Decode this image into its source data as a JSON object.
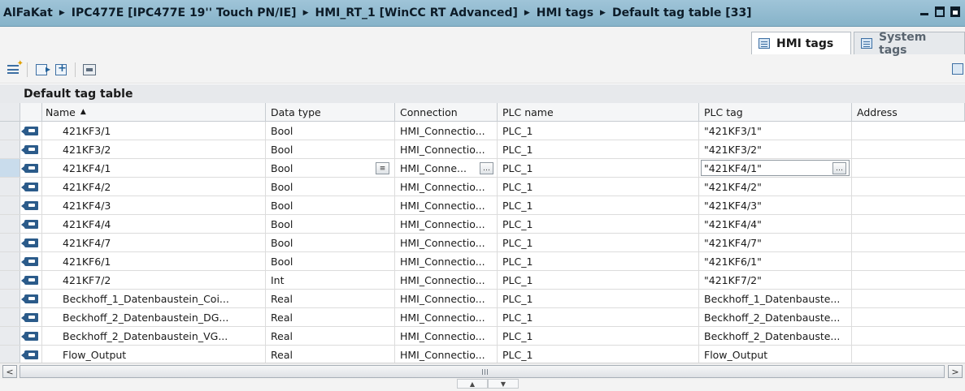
{
  "breadcrumb": [
    "AlFaKat",
    "IPC477E [IPC477E 19'' Touch PN/IE]",
    "HMI_RT_1 [WinCC RT Advanced]",
    "HMI tags",
    "Default tag table [33]"
  ],
  "tabs": {
    "hmi_tags": "HMI tags",
    "system_tags": "System tags"
  },
  "table_title": "Default tag table",
  "columns": {
    "name": "Name",
    "data_type": "Data type",
    "connection": "Connection",
    "plc_name": "PLC name",
    "plc_tag": "PLC tag",
    "address": "Address"
  },
  "rows": [
    {
      "name": "421KF3/1",
      "data_type": "Bool",
      "connection": "HMI_Connectio...",
      "plc_name": "PLC_1",
      "plc_tag": "\"421KF3/1\"",
      "address": ""
    },
    {
      "name": "421KF3/2",
      "data_type": "Bool",
      "connection": "HMI_Connectio...",
      "plc_name": "PLC_1",
      "plc_tag": "\"421KF3/2\"",
      "address": ""
    },
    {
      "name": "421KF4/1",
      "data_type": "Bool",
      "connection": "HMI_Conne...",
      "plc_name": "PLC_1",
      "plc_tag": "\"421KF4/1\"",
      "address": ""
    },
    {
      "name": "421KF4/2",
      "data_type": "Bool",
      "connection": "HMI_Connectio...",
      "plc_name": "PLC_1",
      "plc_tag": "\"421KF4/2\"",
      "address": ""
    },
    {
      "name": "421KF4/3",
      "data_type": "Bool",
      "connection": "HMI_Connectio...",
      "plc_name": "PLC_1",
      "plc_tag": "\"421KF4/3\"",
      "address": ""
    },
    {
      "name": "421KF4/4",
      "data_type": "Bool",
      "connection": "HMI_Connectio...",
      "plc_name": "PLC_1",
      "plc_tag": "\"421KF4/4\"",
      "address": ""
    },
    {
      "name": "421KF4/7",
      "data_type": "Bool",
      "connection": "HMI_Connectio...",
      "plc_name": "PLC_1",
      "plc_tag": "\"421KF4/7\"",
      "address": ""
    },
    {
      "name": "421KF6/1",
      "data_type": "Bool",
      "connection": "HMI_Connectio...",
      "plc_name": "PLC_1",
      "plc_tag": "\"421KF6/1\"",
      "address": ""
    },
    {
      "name": "421KF7/2",
      "data_type": "Int",
      "connection": "HMI_Connectio...",
      "plc_name": "PLC_1",
      "plc_tag": "\"421KF7/2\"",
      "address": ""
    },
    {
      "name": "Beckhoff_1_Datenbaustein_Coi...",
      "data_type": "Real",
      "connection": "HMI_Connectio...",
      "plc_name": "PLC_1",
      "plc_tag": "Beckhoff_1_Datenbauste...",
      "address": ""
    },
    {
      "name": "Beckhoff_2_Datenbaustein_DG...",
      "data_type": "Real",
      "connection": "HMI_Connectio...",
      "plc_name": "PLC_1",
      "plc_tag": "Beckhoff_2_Datenbauste...",
      "address": ""
    },
    {
      "name": "Beckhoff_2_Datenbaustein_VG...",
      "data_type": "Real",
      "connection": "HMI_Connectio...",
      "plc_name": "PLC_1",
      "plc_tag": "Beckhoff_2_Datenbauste...",
      "address": ""
    },
    {
      "name": "Flow_Output",
      "data_type": "Real",
      "connection": "HMI_Connectio...",
      "plc_name": "PLC_1",
      "plc_tag": "Flow_Output",
      "address": ""
    }
  ],
  "selected_row": 2,
  "icons": {
    "add": "add-tag-icon",
    "insert_row": "insert-row-icon",
    "add_row": "add-row-icon",
    "plc_sync": "plc-sync-icon",
    "tag": "hmi-tag-icon"
  },
  "colors": {
    "titlebar": "#9fc4d8",
    "header_bg": "#e7e9ec",
    "tag_icon": "#2b5b8a"
  }
}
